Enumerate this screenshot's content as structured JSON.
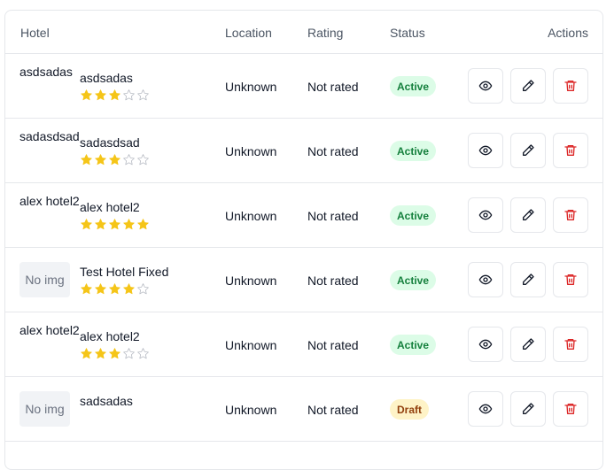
{
  "table": {
    "headers": {
      "hotel": "Hotel",
      "location": "Location",
      "rating": "Rating",
      "status": "Status",
      "actions": "Actions"
    },
    "rows": [
      {
        "thumb_text": "asdsadas",
        "has_no_img_placeholder": false,
        "name": "asdsadas",
        "stars": 3,
        "location": "Unknown",
        "rating": "Not rated",
        "status": "Active",
        "status_kind": "active"
      },
      {
        "thumb_text": "sadasdsad",
        "has_no_img_placeholder": false,
        "name": "sadasdsad",
        "stars": 3,
        "location": "Unknown",
        "rating": "Not rated",
        "status": "Active",
        "status_kind": "active"
      },
      {
        "thumb_text": "alex hotel2",
        "has_no_img_placeholder": false,
        "name": "alex hotel2",
        "stars": 5,
        "location": "Unknown",
        "rating": "Not rated",
        "status": "Active",
        "status_kind": "active"
      },
      {
        "thumb_text": "No img",
        "has_no_img_placeholder": true,
        "name": "Test Hotel Fixed",
        "stars": 4,
        "location": "Unknown",
        "rating": "Not rated",
        "status": "Active",
        "status_kind": "active"
      },
      {
        "thumb_text": "alex hotel2",
        "has_no_img_placeholder": false,
        "name": "alex hotel2",
        "stars": 3,
        "location": "Unknown",
        "rating": "Not rated",
        "status": "Active",
        "status_kind": "active"
      },
      {
        "thumb_text": "No img",
        "has_no_img_placeholder": true,
        "name": "sadsadas",
        "stars": 0,
        "location": "Unknown",
        "rating": "Not rated",
        "status": "Draft",
        "status_kind": "draft"
      }
    ],
    "max_stars": 5,
    "action_icons": [
      "eye-icon",
      "pencil-icon",
      "trash-icon"
    ]
  },
  "colors": {
    "star_filled": "#f5c518",
    "star_empty": "#b8bcc4",
    "active_bg": "#dcfce7",
    "active_text": "#15803d",
    "draft_bg": "#fef3c7",
    "draft_text": "#92400e",
    "delete_icon": "#dc2626"
  }
}
